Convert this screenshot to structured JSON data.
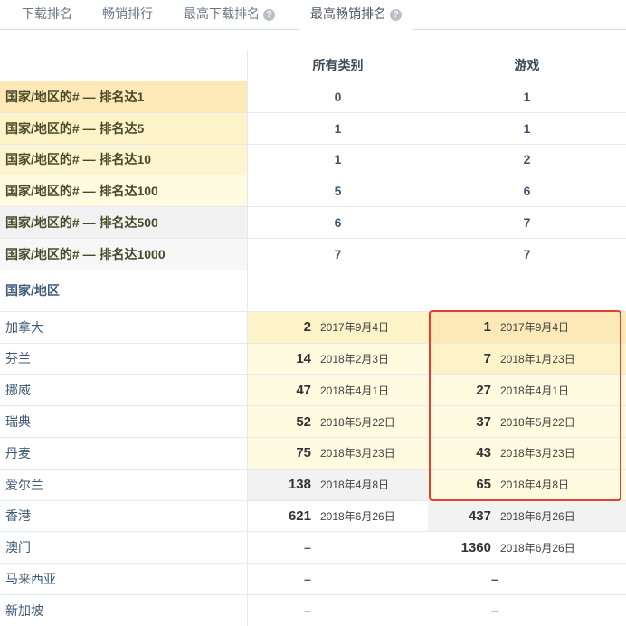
{
  "tabs": [
    {
      "label": "下载排名",
      "help": false,
      "active": false
    },
    {
      "label": "畅销排行",
      "help": false,
      "active": false
    },
    {
      "label": "最高下载排名",
      "help": true,
      "active": false
    },
    {
      "label": "最高畅销排名",
      "help": true,
      "active": true
    }
  ],
  "columns": {
    "all": "所有类别",
    "games": "游戏"
  },
  "rank_rows": [
    {
      "label": "国家/地区的# — 排名达1",
      "all": "0",
      "games": "1"
    },
    {
      "label": "国家/地区的# — 排名达5",
      "all": "1",
      "games": "1"
    },
    {
      "label": "国家/地区的# — 排名达10",
      "all": "1",
      "games": "2"
    },
    {
      "label": "国家/地区的# — 排名达100",
      "all": "5",
      "games": "6"
    },
    {
      "label": "国家/地区的# — 排名达500",
      "all": "6",
      "games": "7"
    },
    {
      "label": "国家/地区的# — 排名达1000",
      "all": "7",
      "games": "7"
    }
  ],
  "section_title": "国家/地区",
  "country_rows": [
    {
      "country": "加拿大",
      "all_rank": "2",
      "all_date": "2017年9月4日",
      "games_rank": "1",
      "games_date": "2017年9月4日"
    },
    {
      "country": "芬兰",
      "all_rank": "14",
      "all_date": "2018年2月3日",
      "games_rank": "7",
      "games_date": "2018年1月23日"
    },
    {
      "country": "挪威",
      "all_rank": "47",
      "all_date": "2018年4月1日",
      "games_rank": "27",
      "games_date": "2018年4月1日"
    },
    {
      "country": "瑞典",
      "all_rank": "52",
      "all_date": "2018年5月22日",
      "games_rank": "37",
      "games_date": "2018年5月22日"
    },
    {
      "country": "丹麦",
      "all_rank": "75",
      "all_date": "2018年3月23日",
      "games_rank": "43",
      "games_date": "2018年3月23日"
    },
    {
      "country": "爱尔兰",
      "all_rank": "138",
      "all_date": "2018年4月8日",
      "games_rank": "65",
      "games_date": "2018年4月8日"
    },
    {
      "country": "香港",
      "all_rank": "621",
      "all_date": "2018年6月26日",
      "games_rank": "437",
      "games_date": "2018年6月26日"
    },
    {
      "country": "澳门",
      "all_rank": "–",
      "all_date": "",
      "games_rank": "1360",
      "games_date": "2018年6月26日"
    },
    {
      "country": "马来西亚",
      "all_rank": "–",
      "all_date": "",
      "games_rank": "–",
      "games_date": ""
    },
    {
      "country": "新加坡",
      "all_rank": "–",
      "all_date": "",
      "games_rank": "–",
      "games_date": ""
    }
  ],
  "colors": {
    "highlight_border": "#e0402f",
    "rank_top": "#fde9b8",
    "rank_light": "#fffbe0"
  }
}
